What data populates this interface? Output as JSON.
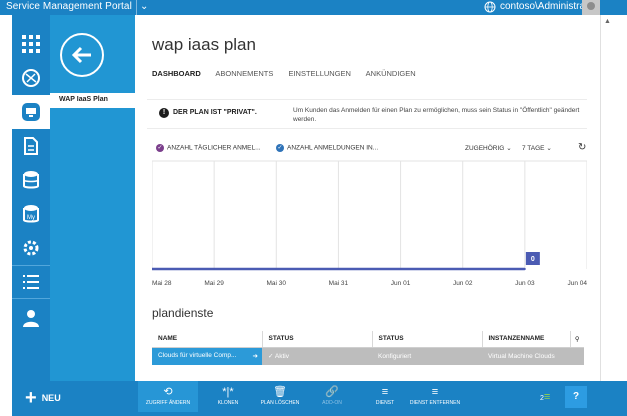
{
  "topbar": {
    "title": "Service Management Portal",
    "user": "contoso\\Administrator"
  },
  "sidebar": {
    "back_label": "",
    "plan_item": "WAP IaaS Plan"
  },
  "page": {
    "title": "wap iaas plan",
    "tabs": [
      {
        "label": "DASHBOARD",
        "active": true
      },
      {
        "label": "ABONNEMENTS",
        "active": false
      },
      {
        "label": "EINSTELLUNGEN",
        "active": false
      },
      {
        "label": "ANKÜNDIGEN",
        "active": false
      }
    ]
  },
  "notice": {
    "heading": "DER PLAN IST \"PRIVAT\".",
    "text": "Um Kunden das Anmelden für einen Plan zu ermöglichen, muss sein Status in \"Öffentlich\" geändert werden."
  },
  "chart_header": {
    "metric1": "ANZAHL TÄGLICHER ANMEL...",
    "metric2": "ANZAHL ANMELDUNGEN IN...",
    "related": "ZUGEHÖRIG",
    "range": "7 TAGE"
  },
  "chart_data": {
    "type": "line",
    "categories": [
      "Mai 28",
      "Mai 29",
      "Mai 30",
      "Mai 31",
      "Jun 01",
      "Jun 02",
      "Jun 03",
      "Jun 04"
    ],
    "series": [
      {
        "values": [
          0,
          0,
          0,
          0,
          0,
          0,
          0,
          null
        ],
        "color": "#4b5bb3"
      }
    ],
    "data_labels": [
      {
        "category": "Jun 03",
        "value": "0"
      }
    ],
    "grid": true
  },
  "services": {
    "title": "plandienste",
    "columns": [
      "NAME",
      "STATUS",
      "STATUS",
      "INSTANZENNAME"
    ],
    "rows": [
      {
        "name": "Clouds für virtuelle Comp...",
        "status1": "Aktiv",
        "status2": "Konfiguriert",
        "instance": "Virtual Machine Clouds"
      }
    ]
  },
  "bottombar": {
    "new_label": "NEU",
    "commands": [
      {
        "label": "ZUGRIFF ÄNDERN",
        "enabled": true
      },
      {
        "label": "KLONEN",
        "enabled": true
      },
      {
        "label": "PLAN LÖSCHEN",
        "enabled": true
      },
      {
        "label": "ADD-ON",
        "enabled": false
      },
      {
        "label": "DIENST",
        "enabled": true
      },
      {
        "label": "DIENST ENTFERNEN",
        "enabled": true
      }
    ],
    "notification_count": "2",
    "help": "?"
  },
  "colors": {
    "brand": "#1b82c4",
    "accent": "#2196d3",
    "metric1": "#7b3f8c",
    "metric2": "#2f73b8",
    "line": "#4b5bb3"
  }
}
